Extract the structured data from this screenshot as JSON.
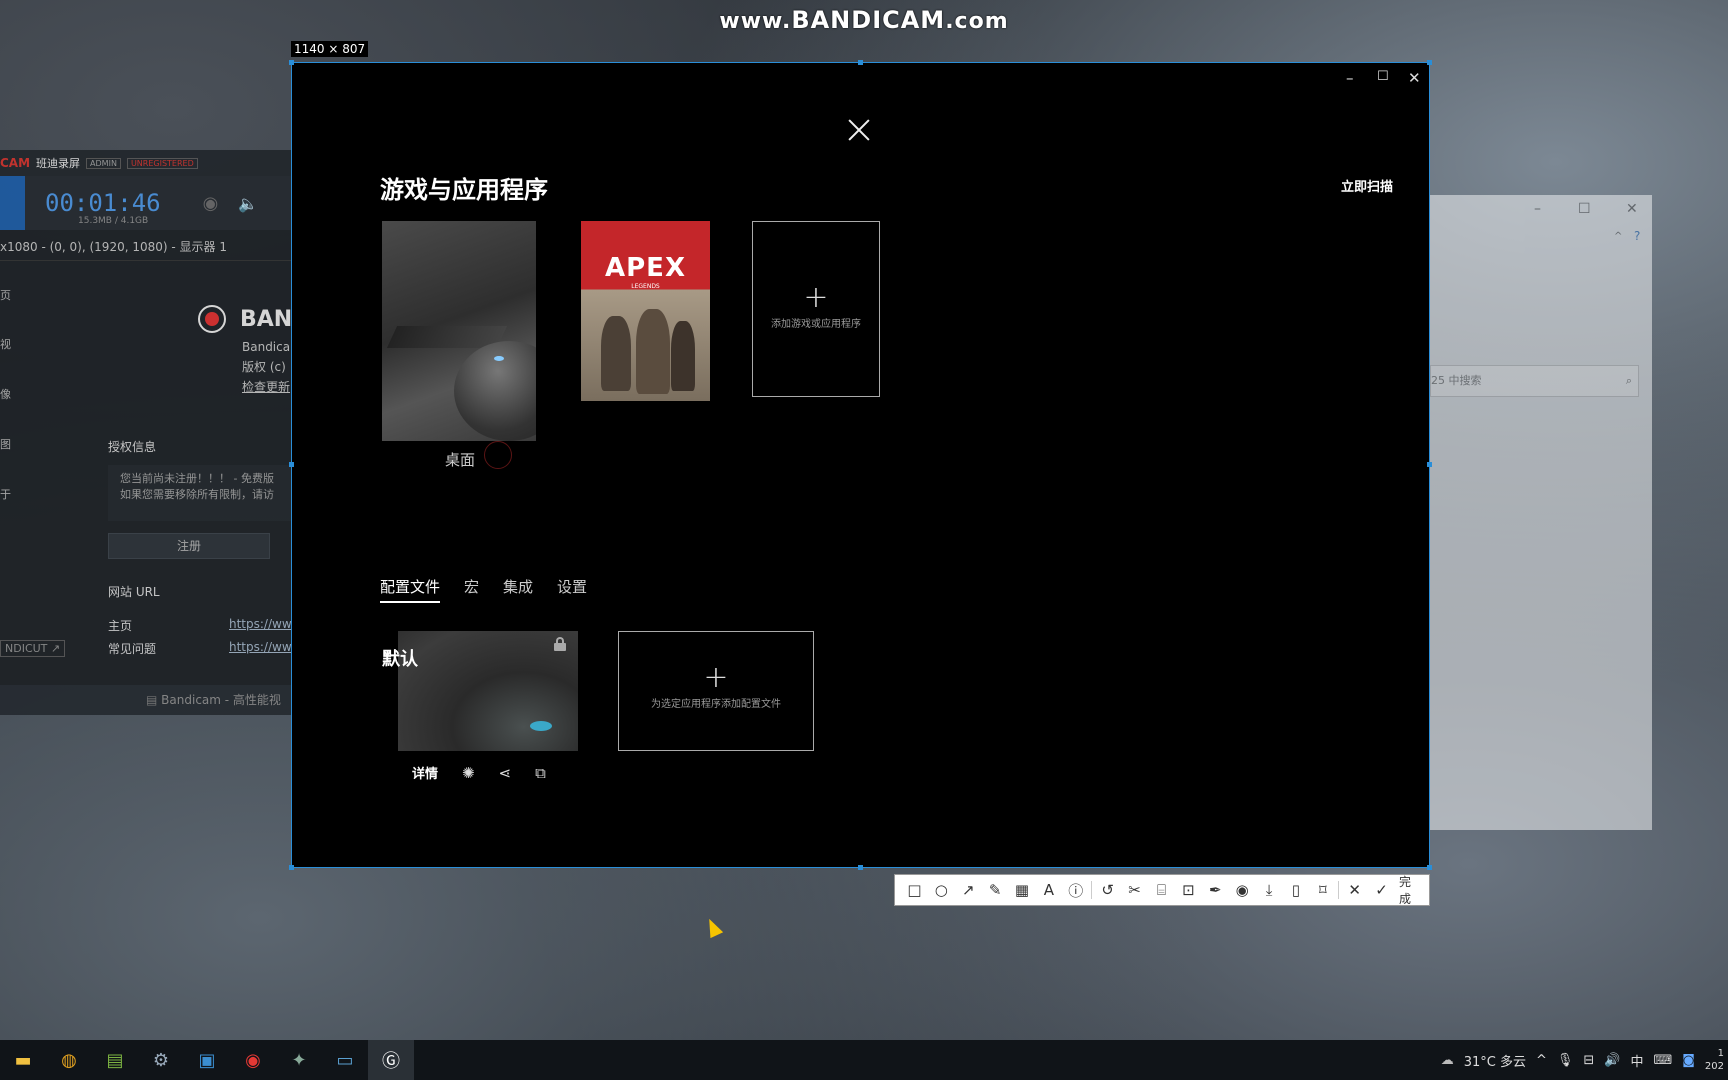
{
  "watermark": {
    "prefix": "www.",
    "brand": "BANDICAM",
    "suffix": ".com"
  },
  "capture": {
    "size_label": "1140 × 807",
    "title": "游戏与应用程序",
    "scan_label": "立即扫描",
    "games": [
      {
        "caption": "桌面"
      },
      {
        "logo": "APEX",
        "sub": "LEGENDS"
      }
    ],
    "add_game_label": "添加游戏或应用程序",
    "tabs": [
      "配置文件",
      "宏",
      "集成",
      "设置"
    ],
    "profile_title": "默认",
    "add_profile_label": "为选定应用程序添加配置文件",
    "details_label": "详情"
  },
  "bandicam": {
    "logo": "CAM",
    "title": "班迪录屏",
    "badge_admin": "ADMIN",
    "badge_unreg": "UNREGISTERED",
    "timer": "00:01:46",
    "size": "15.3MB / 4.1GB",
    "resolution": "x1080 - (0, 0), (1920, 1080) - 显示器 1",
    "side": [
      "页",
      "视",
      "像",
      "图",
      "于"
    ],
    "brand": "BAN",
    "brand_lines": [
      "Bandica",
      "版权 (c) ",
      "检查更新"
    ],
    "license_header": "授权信息",
    "license_note": [
      "您当前尚未注册！！！ - 免费版",
      "如果您需要移除所有限制，请访"
    ],
    "register": "注册",
    "url_header": "网站 URL",
    "url_home": "主页",
    "url_faq": "常见问题",
    "url_value": "https://ww",
    "bandicut": "NDICUT ↗",
    "footer": "Bandicam - 高性能视"
  },
  "explorer": {
    "search": "25 中搜索"
  },
  "toolbar": {
    "done": "完成"
  },
  "tray": {
    "weather": "31°C 多云",
    "ime": "中",
    "time": "1",
    "date": "202"
  }
}
